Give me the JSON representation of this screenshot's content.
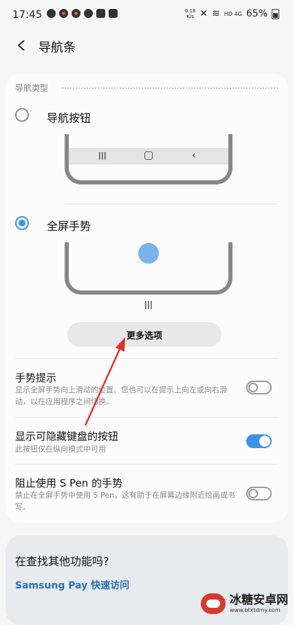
{
  "status_bar": {
    "time": "17:45",
    "speed_value": "0.18",
    "speed_unit": "K/s",
    "network": "HD 4G",
    "battery": "65%"
  },
  "header": {
    "title": "导航条"
  },
  "nav_type": {
    "section_label": "导航类型",
    "options": [
      {
        "label": "导航按钮",
        "selected": false
      },
      {
        "label": "全屏手势",
        "selected": true
      }
    ],
    "more_options_label": "更多选项"
  },
  "settings": [
    {
      "title": "手势提示",
      "description": "显示全屏手势向上滑动的位置。您也可以在提示上向左或向右滑动，以在应用程序之间切换。",
      "enabled": false
    },
    {
      "title": "显示可隐藏键盘的按钮",
      "description": "此按钮仅在纵向模式中可用",
      "enabled": true
    },
    {
      "title": "阻止使用 S Pen 的手势",
      "description": "禁止在全屏手势中使用 S Pen。这有助于在屏幕边缘附近绘画或书写。",
      "enabled": false
    }
  ],
  "suggestions": {
    "title": "在查找其他功能吗?",
    "link": "Samsung Pay 快速访问"
  },
  "watermark": {
    "name": "冰糖安卓网",
    "url": "www.btxtdmy.com"
  },
  "colors": {
    "accent": "#3e91e8",
    "annotation_arrow": "#e0322b",
    "link": "#2a6fb3"
  }
}
